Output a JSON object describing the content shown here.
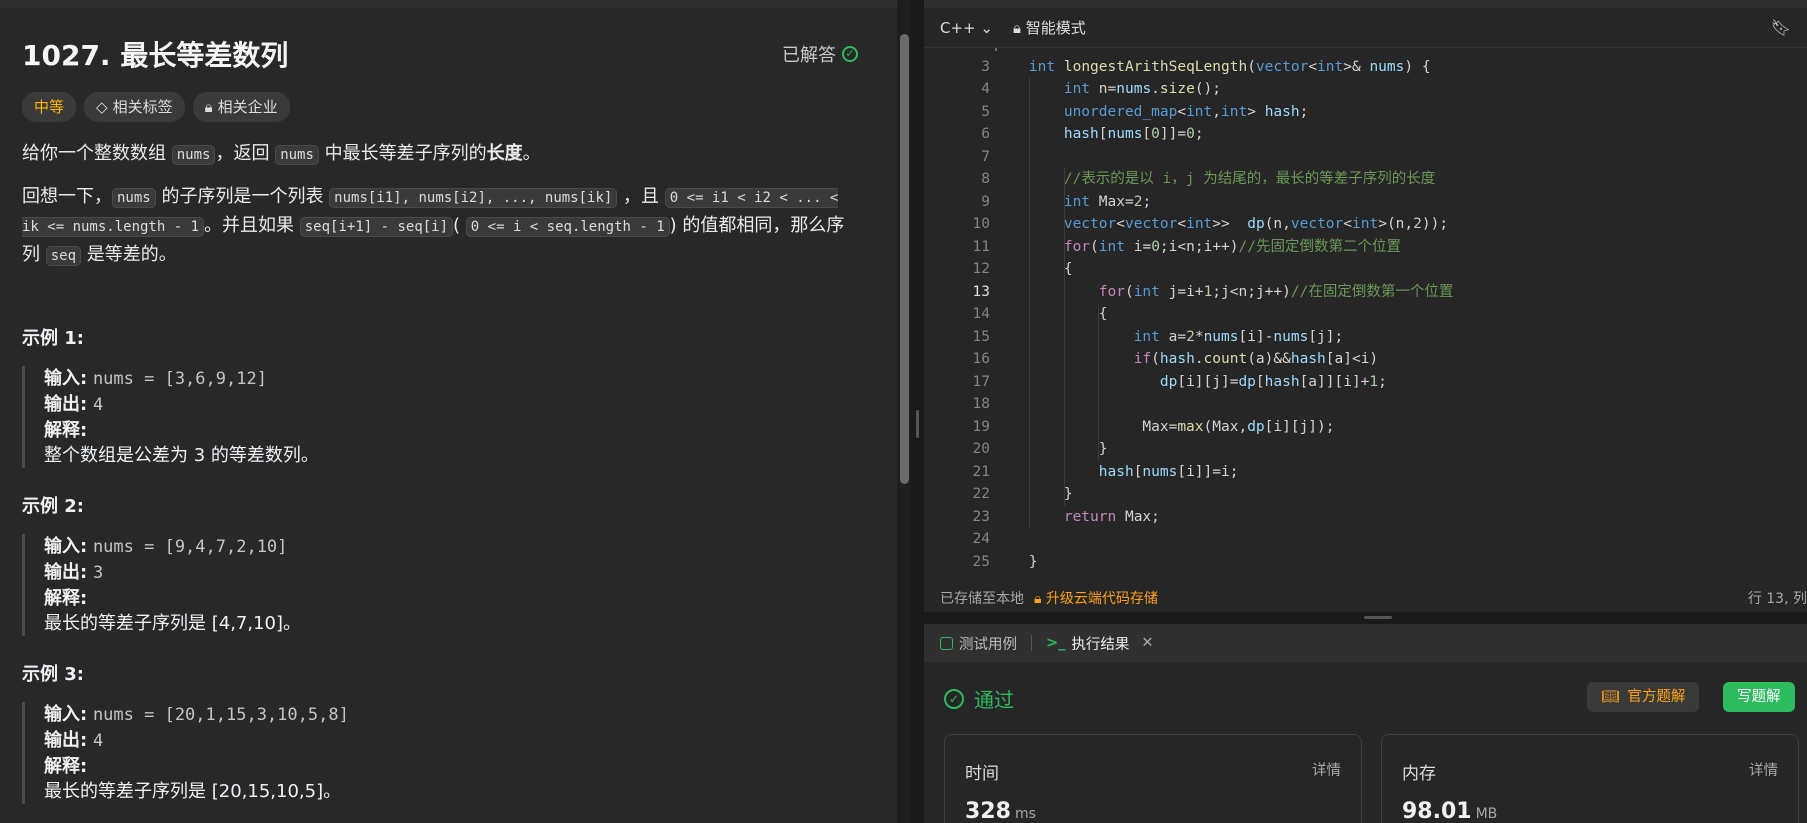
{
  "problem": {
    "title": "1027. 最长等差数列",
    "status": "已解答",
    "tags": {
      "difficulty": "中等",
      "related_tags": "相关标签",
      "related_companies": "相关企业"
    },
    "desc1": {
      "a": "给你一个整数数组 ",
      "code1": "nums",
      "b": "，返回 ",
      "code2": "nums",
      "c": " 中最长等差子序列的",
      "bold": "长度",
      "d": "。"
    },
    "desc2": {
      "a": "回想一下，",
      "code1": "nums",
      "b": " 的子序列是一个列表 ",
      "code2": "nums[i1], nums[i2], ..., nums[ik]",
      "c": " ，且 ",
      "code3": "0 <= i1 < i2 < ... < ik <= nums.length - 1",
      "d": "。并且如果 ",
      "code4": "seq[i+1] - seq[i]",
      "e": "( ",
      "code5": "0 <= i < seq.length - 1",
      "f": ") 的值都相同，那么序列 ",
      "code6": "seq",
      "g": " 是等差的。"
    },
    "examples": [
      {
        "title": "示例 1:",
        "input_label": "输入:",
        "input": "nums = [3,6,9,12]",
        "output_label": "输出:",
        "output": "4",
        "explain_label": "解释:",
        "explain": "整个数组是公差为 3 的等差数列。"
      },
      {
        "title": "示例 2:",
        "input_label": "输入:",
        "input": "nums = [9,4,7,2,10]",
        "output_label": "输出:",
        "output": "3",
        "explain_label": "解释:",
        "explain": "最长的等差子序列是 [4,7,10]。"
      },
      {
        "title": "示例 3:",
        "input_label": "输入:",
        "input": "nums = [20,1,15,3,10,5,8]",
        "output_label": "输出:",
        "output": "4",
        "explain_label": "解释:",
        "explain": "最长的等差子序列是 [20,15,10,5]。"
      }
    ]
  },
  "editor": {
    "language": "C++",
    "mode": "智能模式",
    "active_line": 13,
    "lines": [
      {
        "n": 2,
        "t": "public:"
      },
      {
        "n": 3,
        "t": "    int longestArithSeqLength(vector<int>& nums) {"
      },
      {
        "n": 4,
        "t": "        int n=nums.size();"
      },
      {
        "n": 5,
        "t": "        unordered_map<int,int> hash;"
      },
      {
        "n": 6,
        "t": "        hash[nums[0]]=0;"
      },
      {
        "n": 7,
        "t": ""
      },
      {
        "n": 8,
        "t": "        //表示的是以 i，j 为结尾的，最长的等差子序列的长度"
      },
      {
        "n": 9,
        "t": "        int Max=2;"
      },
      {
        "n": 10,
        "t": "        vector<vector<int>>  dp(n,vector<int>(n,2));"
      },
      {
        "n": 11,
        "t": "        for(int i=0;i<n;i++)//先固定倒数第二个位置"
      },
      {
        "n": 12,
        "t": "        {"
      },
      {
        "n": 13,
        "t": "            for(int j=i+1;j<n;j++)//在固定倒数第一个位置"
      },
      {
        "n": 14,
        "t": "            {"
      },
      {
        "n": 15,
        "t": "                int a=2*nums[i]-nums[j];"
      },
      {
        "n": 16,
        "t": "                if(hash.count(a)&&hash[a]<i)"
      },
      {
        "n": 17,
        "t": "                   dp[i][j]=dp[hash[a]][i]+1;"
      },
      {
        "n": 18,
        "t": ""
      },
      {
        "n": 19,
        "t": "                 Max=max(Max,dp[i][j]);"
      },
      {
        "n": 20,
        "t": "            }"
      },
      {
        "n": 21,
        "t": "            hash[nums[i]]=i;"
      },
      {
        "n": 22,
        "t": "        }"
      },
      {
        "n": 23,
        "t": "        return Max;"
      },
      {
        "n": 24,
        "t": ""
      },
      {
        "n": 25,
        "t": "    }"
      }
    ],
    "status_saved": "已存储至本地",
    "status_upgrade": "升级云端代码存储",
    "status_position": "行 13, 列"
  },
  "result": {
    "tab_testcase": "测试用例",
    "tab_result": "执行结果",
    "verdict": "通过",
    "btn_official": "官方题解",
    "btn_write": "写题解",
    "time_label": "时间",
    "time_detail": "详情",
    "time_value": "328",
    "time_unit": "ms",
    "mem_label": "内存",
    "mem_detail": "详情",
    "mem_value": "98.01",
    "mem_unit": "MB"
  }
}
